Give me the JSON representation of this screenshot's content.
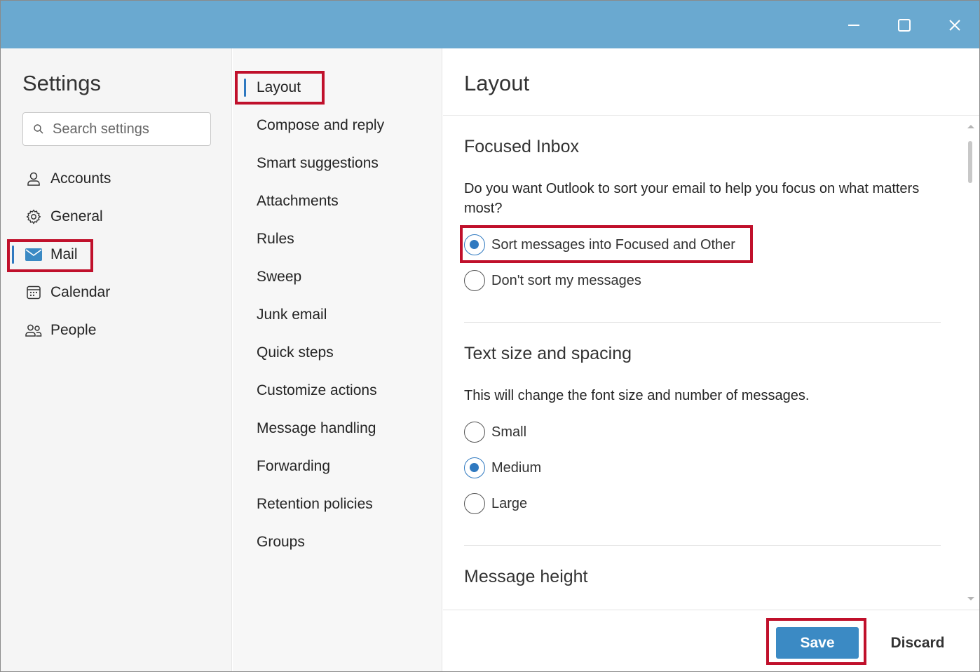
{
  "window": {
    "controls": {
      "minimize_icon": "minimize-icon",
      "maximize_icon": "maximize-icon",
      "close_icon": "close-icon"
    },
    "titlebar_color": "#6aa9d0"
  },
  "sidebar": {
    "title": "Settings",
    "search_placeholder": "Search settings",
    "items": [
      {
        "label": "Accounts",
        "icon": "person-icon"
      },
      {
        "label": "General",
        "icon": "gear-icon"
      },
      {
        "label": "Mail",
        "icon": "mail-icon",
        "selected": true
      },
      {
        "label": "Calendar",
        "icon": "calendar-icon"
      },
      {
        "label": "People",
        "icon": "people-icon"
      }
    ]
  },
  "submenu": {
    "items": [
      {
        "label": "Layout",
        "selected": true
      },
      {
        "label": "Compose and reply"
      },
      {
        "label": "Smart suggestions"
      },
      {
        "label": "Attachments"
      },
      {
        "label": "Rules"
      },
      {
        "label": "Sweep"
      },
      {
        "label": "Junk email"
      },
      {
        "label": "Quick steps"
      },
      {
        "label": "Customize actions"
      },
      {
        "label": "Message handling"
      },
      {
        "label": "Forwarding"
      },
      {
        "label": "Retention policies"
      },
      {
        "label": "Groups"
      }
    ]
  },
  "main": {
    "title": "Layout",
    "focused_inbox": {
      "heading": "Focused Inbox",
      "question": "Do you want Outlook to sort your email to help you focus on what matters most?",
      "options": [
        {
          "label": "Sort messages into Focused and Other",
          "selected": true
        },
        {
          "label": "Don't sort my messages",
          "selected": false
        }
      ]
    },
    "text_size": {
      "heading": "Text size and spacing",
      "description": "This will change the font size and number of messages.",
      "options": [
        {
          "label": "Small",
          "selected": false
        },
        {
          "label": "Medium",
          "selected": true
        },
        {
          "label": "Large",
          "selected": false
        }
      ]
    },
    "message_height": {
      "heading": "Message height"
    }
  },
  "footer": {
    "save_label": "Save",
    "discard_label": "Discard"
  },
  "colors": {
    "accent": "#2f79c0",
    "save_button": "#3b8ac4",
    "highlight": "#c0102b"
  }
}
